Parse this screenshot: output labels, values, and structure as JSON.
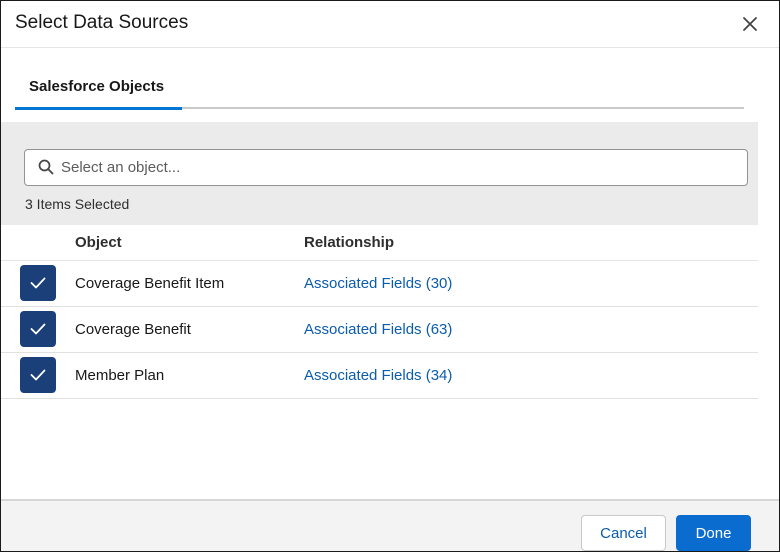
{
  "modal": {
    "title": "Select Data Sources",
    "close_icon": "close-icon"
  },
  "tabs": [
    {
      "label": "Salesforce Objects",
      "active": true
    }
  ],
  "search": {
    "placeholder": "Select an object...",
    "value": "",
    "icon": "search-icon"
  },
  "selection": {
    "count_text": "3 Items Selected"
  },
  "table": {
    "headers": {
      "object": "Object",
      "relationship": "Relationship"
    },
    "rows": [
      {
        "checked": true,
        "object": "Coverage Benefit Item",
        "relationship": "Associated Fields (30)"
      },
      {
        "checked": true,
        "object": "Coverage Benefit",
        "relationship": "Associated Fields (63)"
      },
      {
        "checked": true,
        "object": "Member Plan",
        "relationship": "Associated Fields (34)"
      }
    ]
  },
  "footer": {
    "cancel_label": "Cancel",
    "done_label": "Done"
  },
  "colors": {
    "accent": "#0176d3",
    "checkbox": "#1b3f78",
    "link": "#0b5cab",
    "primary_button": "#0b6ccf"
  }
}
